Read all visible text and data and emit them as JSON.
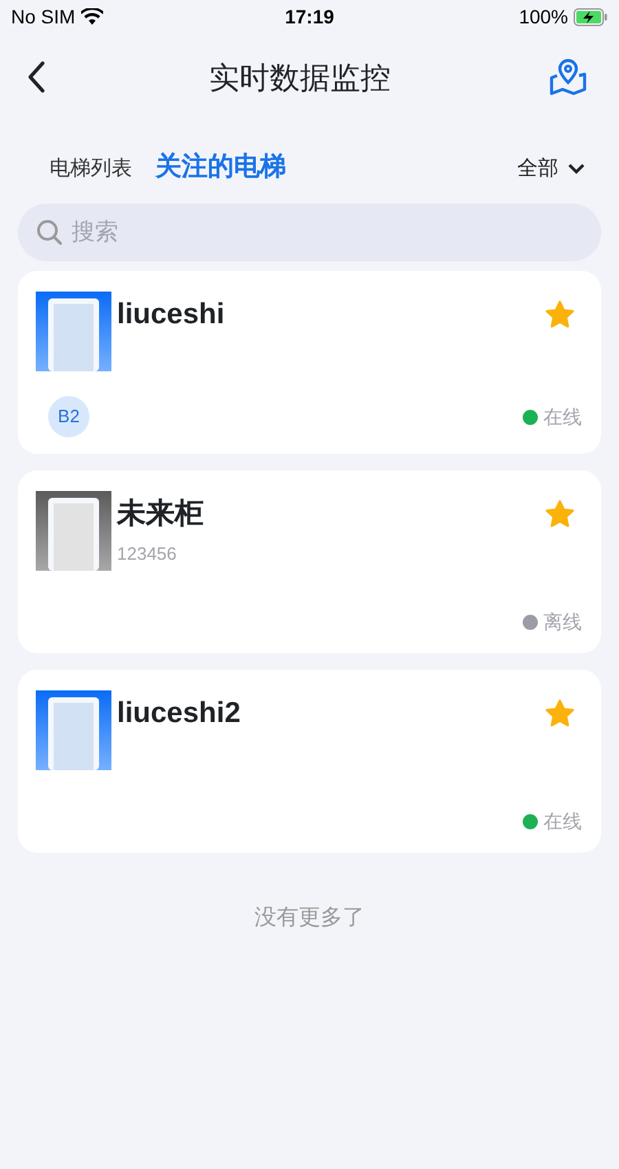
{
  "status_bar": {
    "carrier": "No SIM",
    "time": "17:19",
    "battery": "100%"
  },
  "header": {
    "title": "实时数据监控"
  },
  "tabs": [
    {
      "label": "电梯列表",
      "selected": false
    },
    {
      "label": "关注的电梯",
      "selected": true
    }
  ],
  "filter": {
    "label": "全部"
  },
  "search": {
    "placeholder": "搜索"
  },
  "elevators": [
    {
      "name": "liuceshi",
      "online": true,
      "starred": true,
      "tag": "B2",
      "status": {
        "label": "在线",
        "color": "#1db155"
      }
    },
    {
      "name": "未来柜",
      "code": "123456",
      "online": false,
      "starred": true,
      "status": {
        "label": "离线",
        "color": "#9a9ca6"
      }
    },
    {
      "name": "liuceshi2",
      "online": true,
      "starred": true,
      "status": {
        "label": "在线",
        "color": "#1db155"
      }
    }
  ],
  "footer": "没有更多了"
}
